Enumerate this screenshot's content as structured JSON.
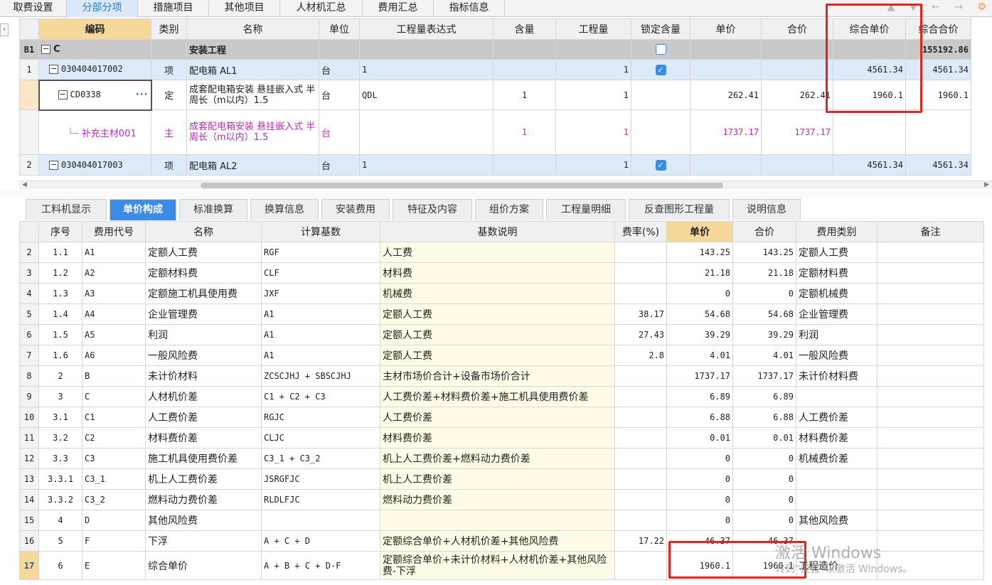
{
  "top_tabs": [
    {
      "label": "取费设置"
    },
    {
      "label": "分部分项"
    },
    {
      "label": "措施项目"
    },
    {
      "label": "其他项目"
    },
    {
      "label": "人材机汇总"
    },
    {
      "label": "费用汇总"
    },
    {
      "label": "指标信息"
    }
  ],
  "upper": {
    "headers": [
      "编码",
      "类别",
      "名称",
      "单位",
      "工程量表达式",
      "含量",
      "工程量",
      "锁定含量",
      "单价",
      "合价",
      "综合单价",
      "综合合价"
    ],
    "b1": {
      "rowno": "B1",
      "code": "C",
      "name": "安装工程",
      "total": "155192.86"
    },
    "r1": {
      "rowno": "1",
      "code": "030404017002",
      "type": "项",
      "name": "配电箱 AL1",
      "unit": "台",
      "expr": "1",
      "qty": "1",
      "unit_price": "4561.34",
      "total": "4561.34"
    },
    "rcd": {
      "code": "CD0338",
      "type": "定",
      "name": "成套配电箱安装 悬挂嵌入式 半周长（m以内）1.5",
      "unit": "台",
      "expr": "QDL",
      "content": "1",
      "qty": "1",
      "price": "262.41",
      "amount": "262.41",
      "unit_price": "1960.1",
      "total": "1960.1"
    },
    "rzc": {
      "code": "补充主材001",
      "type": "主",
      "name": "成套配电箱安装 悬挂嵌入式 半周长（m以内）1.5",
      "unit": "台",
      "content": "1",
      "qty": "1",
      "price": "1737.17",
      "amount": "1737.17"
    },
    "r2": {
      "rowno": "2",
      "code": "030404017003",
      "type": "项",
      "name": "配电箱 AL2",
      "unit": "台",
      "expr": "1",
      "qty": "1",
      "unit_price": "4561.34",
      "total": "4561.34"
    }
  },
  "sub_tabs": [
    {
      "label": "工料机显示"
    },
    {
      "label": "单价构成"
    },
    {
      "label": "标准换算"
    },
    {
      "label": "换算信息"
    },
    {
      "label": "安装费用"
    },
    {
      "label": "特征及内容"
    },
    {
      "label": "组价方案"
    },
    {
      "label": "工程量明细"
    },
    {
      "label": "反查图形工程量"
    },
    {
      "label": "说明信息"
    }
  ],
  "lower": {
    "headers": [
      "序号",
      "费用代号",
      "名称",
      "计算基数",
      "基数说明",
      "费率(%)",
      "单价",
      "合价",
      "费用类别",
      "备注"
    ],
    "rows": [
      {
        "rowno": "2",
        "seq": "1.1",
        "code": "A1",
        "name": "定额人工费",
        "base": "RGF",
        "desc": "人工费",
        "rate": "",
        "price": "143.25",
        "amount": "143.25",
        "category": "定额人工费"
      },
      {
        "rowno": "3",
        "seq": "1.2",
        "code": "A2",
        "name": "定额材料费",
        "base": "CLF",
        "desc": "材料费",
        "rate": "",
        "price": "21.18",
        "amount": "21.18",
        "category": "定额材料费"
      },
      {
        "rowno": "4",
        "seq": "1.3",
        "code": "A3",
        "name": "定额施工机具使用费",
        "base": "JXF",
        "desc": "机械费",
        "rate": "",
        "price": "0",
        "amount": "0",
        "category": "定额机械费"
      },
      {
        "rowno": "5",
        "seq": "1.4",
        "code": "A4",
        "name": "企业管理费",
        "base": "A1",
        "desc": "定额人工费",
        "rate": "38.17",
        "price": "54.68",
        "amount": "54.68",
        "category": "企业管理费"
      },
      {
        "rowno": "6",
        "seq": "1.5",
        "code": "A5",
        "name": "利润",
        "base": "A1",
        "desc": "定额人工费",
        "rate": "27.43",
        "price": "39.29",
        "amount": "39.29",
        "category": "利润"
      },
      {
        "rowno": "7",
        "seq": "1.6",
        "code": "A6",
        "name": "一般风险费",
        "base": "A1",
        "desc": "定额人工费",
        "rate": "2.8",
        "price": "4.01",
        "amount": "4.01",
        "category": "一般风险费"
      },
      {
        "rowno": "8",
        "seq": "2",
        "code": "B",
        "name": "未计价材料",
        "base": "ZCSCJHJ + SBSCJHJ",
        "desc": "主材市场价合计+设备市场价合计",
        "rate": "",
        "price": "1737.17",
        "amount": "1737.17",
        "category": "未计价材料费"
      },
      {
        "rowno": "9",
        "seq": "3",
        "code": "C",
        "name": "人材机价差",
        "base": "C1 + C2 + C3",
        "desc": "人工费价差+材料费价差+施工机具使用费价差",
        "rate": "",
        "price": "6.89",
        "amount": "6.89",
        "category": ""
      },
      {
        "rowno": "10",
        "seq": "3.1",
        "code": "C1",
        "name": "人工费价差",
        "base": "RGJC",
        "desc": "人工费价差",
        "rate": "",
        "price": "6.88",
        "amount": "6.88",
        "category": "人工费价差"
      },
      {
        "rowno": "11",
        "seq": "3.2",
        "code": "C2",
        "name": "材料费价差",
        "base": "CLJC",
        "desc": "材料费价差",
        "rate": "",
        "price": "0.01",
        "amount": "0.01",
        "category": "材料费价差"
      },
      {
        "rowno": "12",
        "seq": "3.3",
        "code": "C3",
        "name": "施工机具使用费价差",
        "base": "C3_1 + C3_2",
        "desc": "机上人工费价差+燃料动力费价差",
        "rate": "",
        "price": "0",
        "amount": "0",
        "category": "机械费价差"
      },
      {
        "rowno": "13",
        "seq": "3.3.1",
        "code": "C3_1",
        "name": "机上人工费价差",
        "base": "JSRGFJC",
        "desc": "机上人工费价差",
        "rate": "",
        "price": "0",
        "amount": "0",
        "category": ""
      },
      {
        "rowno": "14",
        "seq": "3.3.2",
        "code": "C3_2",
        "name": "燃料动力费价差",
        "base": "RLDLFJC",
        "desc": "燃料动力费价差",
        "rate": "",
        "price": "0",
        "amount": "0",
        "category": ""
      },
      {
        "rowno": "15",
        "seq": "4",
        "code": "D",
        "name": "其他风险费",
        "base": "",
        "desc": "",
        "rate": "",
        "price": "0",
        "amount": "0",
        "category": "其他风险费"
      },
      {
        "rowno": "16",
        "seq": "5",
        "code": "F",
        "name": "下浮",
        "base": "A + C + D",
        "desc": "定额综合单价+人材机价差+其他风险费",
        "rate": "17.22",
        "price": "46.37",
        "amount": "46.37",
        "category": ""
      }
    ],
    "last": {
      "rowno": "17",
      "seq": "6",
      "code": "E",
      "name": "综合单价",
      "base": "A + B + C + D-F",
      "desc": "定额综合单价+未计价材料+人材机价差+其他风险费-下浮",
      "rate": "",
      "price": "1960.1",
      "amount": "1960.1",
      "category": "工程造价"
    }
  },
  "watermark": {
    "line1": "激活 Windows",
    "line2": "转到“设置”以激活 Windows。"
  },
  "colors": {
    "accent": "#3c8ce7",
    "highlight_box": "#e0261a",
    "header_active": "#f6d99a",
    "selected_row": "#dceaf9"
  }
}
